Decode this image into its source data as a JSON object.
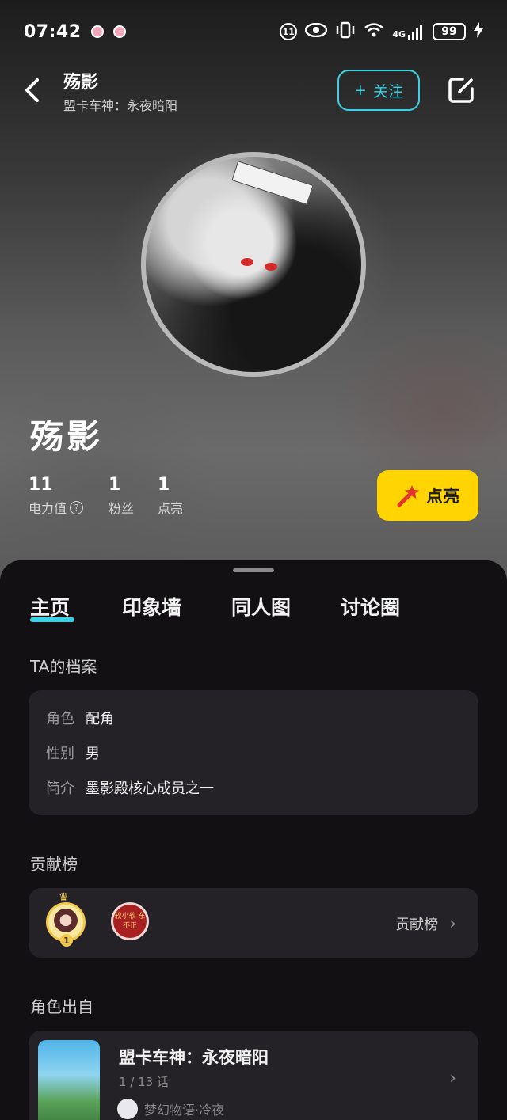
{
  "status_bar": {
    "time": "07:42",
    "notification_count": "11",
    "network": "4G",
    "battery": "99"
  },
  "nav": {
    "title": "殇影",
    "subtitle": "盟卡车神：永夜暗阳",
    "follow_plus": "+",
    "follow_label": "关注"
  },
  "profile": {
    "name": "殇影",
    "stats": [
      {
        "value": "11",
        "label": "电力值"
      },
      {
        "value": "1",
        "label": "粉丝"
      },
      {
        "value": "1",
        "label": "点亮"
      }
    ],
    "light_button": "点亮"
  },
  "tabs": [
    "主页",
    "印象墙",
    "同人图",
    "讨论圈"
  ],
  "archive": {
    "title": "TA的档案",
    "rows": [
      {
        "key": "角色",
        "value": "配角"
      },
      {
        "key": "性别",
        "value": "男"
      },
      {
        "key": "简介",
        "value": "墨影殿核心成员之一"
      }
    ]
  },
  "contribution": {
    "title": "贡献榜",
    "link": "贡献榜",
    "rank_badge": "1",
    "second_avatar_text": "软小软 东不正"
  },
  "origin": {
    "title": "角色出自",
    "work_title": "盟卡车神：永夜暗阳",
    "episode": "1 / 13 话",
    "author": "梦幻物语·冷夜"
  },
  "colors": {
    "accent": "#3ad3e6",
    "light_button_bg": "#ffd400",
    "sheet_bg": "#121013",
    "card_bg": "#242226"
  },
  "icons": {
    "back": "chevron-left-icon",
    "edit": "edit-icon",
    "help": "question-circle-icon",
    "wand": "magic-wand-icon",
    "chevron": "chevron-right-icon"
  }
}
